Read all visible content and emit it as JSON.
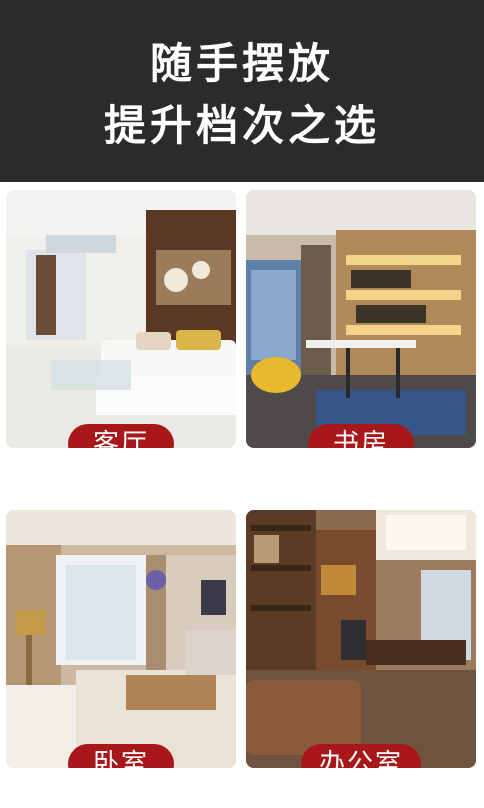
{
  "header": {
    "line1": "随手摆放",
    "line2": "提升档次之选"
  },
  "rooms": [
    {
      "label": "客厅",
      "image": "living-room-image"
    },
    {
      "label": "书房",
      "image": "study-room-image"
    },
    {
      "label": "卧室",
      "image": "bedroom-image"
    },
    {
      "label": "办公室",
      "image": "office-image"
    }
  ],
  "colors": {
    "header_bg": "#2b2b2b",
    "pill": "#a8181b",
    "text": "#ffffff"
  }
}
